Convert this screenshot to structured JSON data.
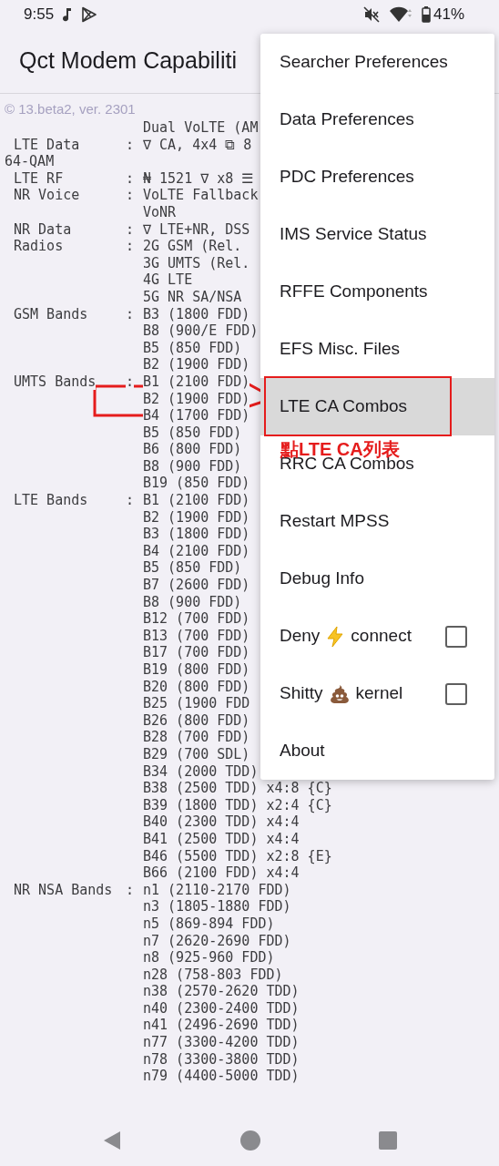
{
  "status_bar": {
    "time": "9:55",
    "battery": "41%"
  },
  "app_bar": {
    "title": "Qct Modem Capabiliti"
  },
  "version": "© 13.beta2, ver. 2301",
  "report": [
    {
      "kind": "field",
      "values": [
        "Dual VoLTE (AM"
      ]
    },
    {
      "kind": "field",
      "label": "LTE Data",
      "separator": ":",
      "values": [
        "∇ CA, 4x4 ⧉ 8"
      ]
    },
    {
      "kind": "wrap",
      "text": "64-QAM"
    },
    {
      "kind": "field",
      "label": "LTE RF",
      "separator": ":",
      "values": [
        "₦ 1521 ∇ x8 ☰"
      ]
    },
    {
      "kind": "field",
      "label": "NR Voice",
      "separator": ":",
      "values": [
        "VoLTE Fallback",
        "VoNR"
      ]
    },
    {
      "kind": "field",
      "label": "NR Data",
      "separator": ":",
      "values": [
        "∇ LTE+NR, DSS"
      ]
    },
    {
      "kind": "field",
      "label": "Radios",
      "separator": ":",
      "values": [
        "2G GSM (Rel.",
        "3G UMTS (Rel.",
        "4G LTE",
        "5G NR SA/NSA"
      ]
    },
    {
      "kind": "field",
      "label": "GSM Bands",
      "separator": ":",
      "values": [
        "B3 (1800 FDD)",
        "B8 (900/E FDD)",
        "B5 (850 FDD)",
        "B2 (1900 FDD)"
      ]
    },
    {
      "kind": "field",
      "label": "UMTS Bands",
      "separator": ":",
      "values": [
        "B1 (2100 FDD)",
        "B2 (1900 FDD)",
        "B4 (1700 FDD)",
        "B5 (850 FDD)",
        "B6 (800 FDD)",
        "B8 (900 FDD)",
        "B19 (850 FDD)"
      ]
    },
    {
      "kind": "field",
      "label": "LTE Bands",
      "separator": ":",
      "values": [
        "B1 (2100 FDD)",
        "B2 (1900 FDD)",
        "B3 (1800 FDD)",
        "B4 (2100 FDD)",
        "B5 (850 FDD)",
        "B7 (2600 FDD)",
        "B8 (900 FDD)",
        "B12 (700 FDD)",
        "B13 (700 FDD)",
        "B17 (700 FDD)",
        "B19 (800 FDD)",
        "B20 (800 FDD)",
        "B25 (1900 FDD",
        "B26 (800 FDD)",
        "B28 (700 FDD)",
        "B29 (700 SDL)",
        "B34 (2000 TDD)",
        "B38 (2500 TDD) x4:8 {C}",
        "B39 (1800 TDD) x2:4 {C}",
        "B40 (2300 TDD) x4:4",
        "B41 (2500 TDD) x4:4",
        "B46 (5500 TDD) x2:8 {E}",
        "B66 (2100 FDD) x4:4"
      ]
    },
    {
      "kind": "field",
      "label": "NR NSA Bands",
      "separator": ":",
      "values": [
        "n1 (2110-2170 FDD)",
        "n3 (1805-1880 FDD)",
        "n5 (869-894 FDD)",
        "n7 (2620-2690 FDD)",
        "n8 (925-960 FDD)",
        "n28 (758-803 FDD)",
        "n38 (2570-2620 TDD)",
        "n40 (2300-2400 TDD)",
        "n41 (2496-2690 TDD)",
        "n77 (3300-4200 TDD)",
        "n78 (3300-3800 TDD)",
        "n79 (4400-5000 TDD)"
      ]
    }
  ],
  "menu": [
    {
      "kind": "action",
      "label": "Searcher Preferences",
      "selected": false
    },
    {
      "kind": "action",
      "label": "Data Preferences",
      "selected": false
    },
    {
      "kind": "action",
      "label": "PDC Preferences",
      "selected": false
    },
    {
      "kind": "action",
      "label": "IMS Service Status",
      "selected": false
    },
    {
      "kind": "action",
      "label": "RFFE Components",
      "selected": false
    },
    {
      "kind": "action",
      "label": "EFS Misc. Files",
      "selected": false
    },
    {
      "kind": "action",
      "label": "LTE CA Combos",
      "selected": true
    },
    {
      "kind": "action",
      "label": "RRC CA Combos",
      "selected": false
    },
    {
      "kind": "action",
      "label": "Restart MPSS",
      "selected": false
    },
    {
      "kind": "action",
      "label": "Debug Info",
      "selected": false
    },
    {
      "kind": "checkbox",
      "label": "Deny",
      "label_after": "connect",
      "checked": false
    },
    {
      "kind": "checkbox",
      "label": "Shitty",
      "label_after": "kernel",
      "checked": false
    },
    {
      "kind": "action",
      "label": "About",
      "selected": false
    }
  ],
  "annotation": {
    "text": "點LTE CA列表"
  }
}
